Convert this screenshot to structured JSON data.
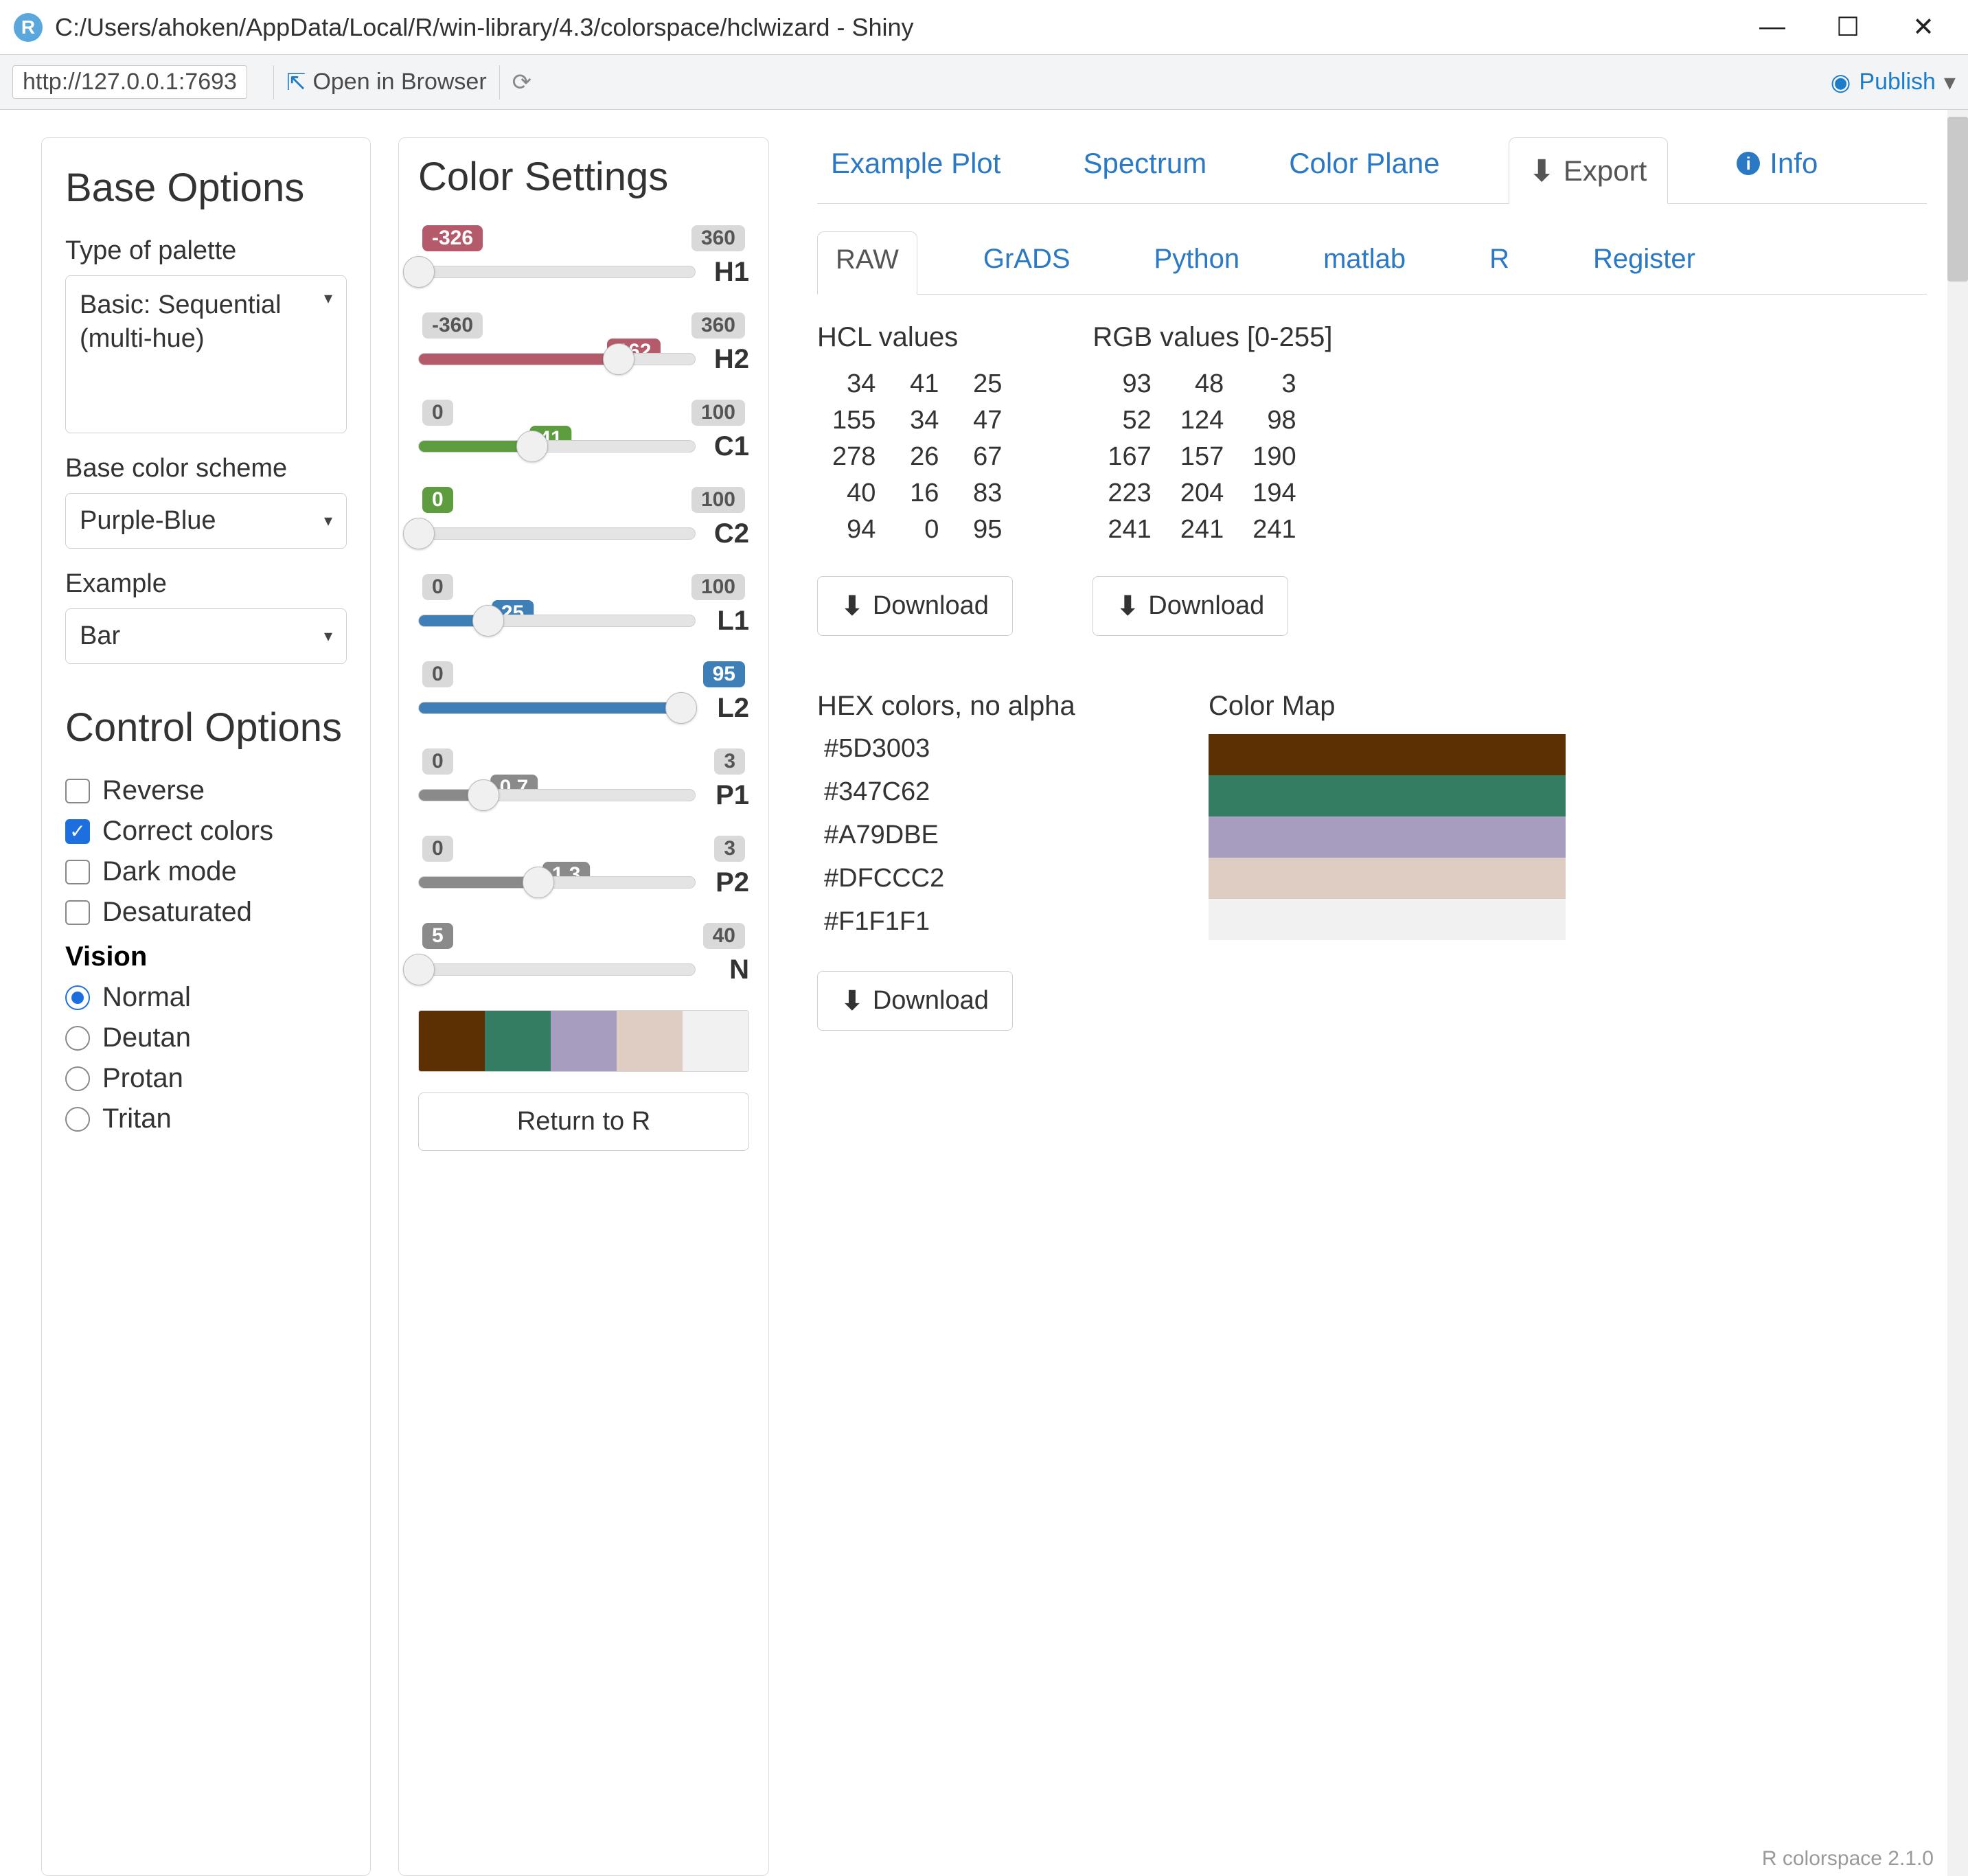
{
  "window": {
    "title": "C:/Users/ahoken/AppData/Local/R/win-library/4.3/colorspace/hclwizard - Shiny",
    "url": "http://127.0.0.1:7693",
    "open_browser": "Open in Browser",
    "publish": "Publish"
  },
  "base_options": {
    "heading": "Base Options",
    "type_label": "Type of palette",
    "type_value": "Basic: Sequential (multi-hue)",
    "scheme_label": "Base color scheme",
    "scheme_value": "Purple-Blue",
    "example_label": "Example",
    "example_value": "Bar"
  },
  "control_options": {
    "heading": "Control Options",
    "reverse": "Reverse",
    "correct": "Correct colors",
    "dark": "Dark mode",
    "desat": "Desaturated",
    "vision_heading": "Vision",
    "vision": [
      "Normal",
      "Deutan",
      "Protan",
      "Tritan"
    ]
  },
  "color_settings": {
    "heading": "Color Settings",
    "sliders": {
      "H1": {
        "min": -326,
        "max": 360,
        "value": -326,
        "color": "red"
      },
      "H2": {
        "min": -360,
        "max": 360,
        "value": 162,
        "color": "red"
      },
      "C1": {
        "min": 0,
        "max": 100,
        "value": 41,
        "color": "green"
      },
      "C2": {
        "min": 0,
        "max": 100,
        "value": 0,
        "color": "green"
      },
      "L1": {
        "min": 0,
        "max": 100,
        "value": 25,
        "color": "blue"
      },
      "L2": {
        "min": 0,
        "max": 100,
        "value": 95,
        "color": "blue"
      },
      "P1": {
        "min": 0,
        "max": 3,
        "value": 0.7,
        "color": "grey"
      },
      "P2": {
        "min": 0,
        "max": 3,
        "value": 1.3,
        "color": "grey"
      },
      "N": {
        "min": 5,
        "max": 40,
        "value": 5,
        "color": "grey"
      }
    },
    "return_btn": "Return to R"
  },
  "palette_colors": [
    "#5D3003",
    "#347C62",
    "#A79DBE",
    "#DFCCC2",
    "#F1F1F1"
  ],
  "tabs": [
    "Example Plot",
    "Spectrum",
    "Color Plane",
    "Export",
    "Info"
  ],
  "subtabs": [
    "RAW",
    "GrADS",
    "Python",
    "matlab",
    "R",
    "Register"
  ],
  "export": {
    "hcl_title": "HCL values",
    "rgb_title": "RGB values [0-255]",
    "hcl_rows": [
      [
        34,
        41,
        25
      ],
      [
        155,
        34,
        47
      ],
      [
        278,
        26,
        67
      ],
      [
        40,
        16,
        83
      ],
      [
        94,
        0,
        95
      ]
    ],
    "rgb_rows": [
      [
        93,
        48,
        3
      ],
      [
        52,
        124,
        98
      ],
      [
        167,
        157,
        190
      ],
      [
        223,
        204,
        194
      ],
      [
        241,
        241,
        241
      ]
    ],
    "hex_title": "HEX colors, no alpha",
    "cmap_title": "Color Map",
    "download": "Download"
  },
  "footer": "R colorspace 2.1.0"
}
